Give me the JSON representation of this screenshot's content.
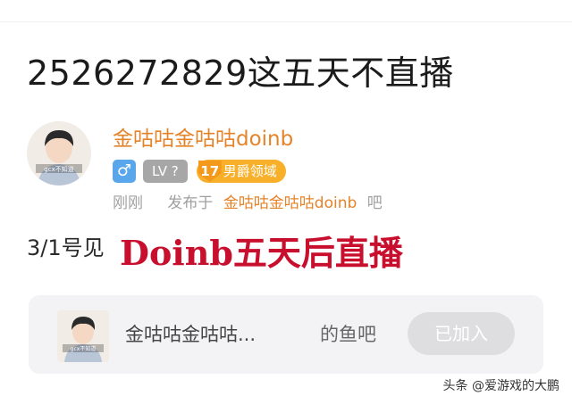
{
  "post": {
    "title": "2526272829这五天不直播",
    "author": {
      "name": "金咕咕金咕咕doinb",
      "gender_symbol": "♂",
      "level_label": "LV ?",
      "rank_number": "17",
      "rank_title": "男爵领域",
      "avatar_caption": "gcx不知道"
    },
    "meta": {
      "time": "刚刚",
      "published_in_label": "发布于",
      "bar_name": "金咕咕金咕咕doinb",
      "bar_suffix": "吧"
    },
    "body": "3/1号见",
    "overlay_caption": "Doinb五天后直播"
  },
  "forum_card": {
    "name": "金咕咕金咕咕...",
    "suffix": "的鱼吧",
    "joined_label": "已加入"
  },
  "watermark": "头条 @爱游戏的大鹏",
  "colors": {
    "accent_orange": "#e5832a",
    "caption_red": "#c8102e",
    "gender_blue": "#5aa6ea",
    "rank_gold": "#f8b02b"
  }
}
